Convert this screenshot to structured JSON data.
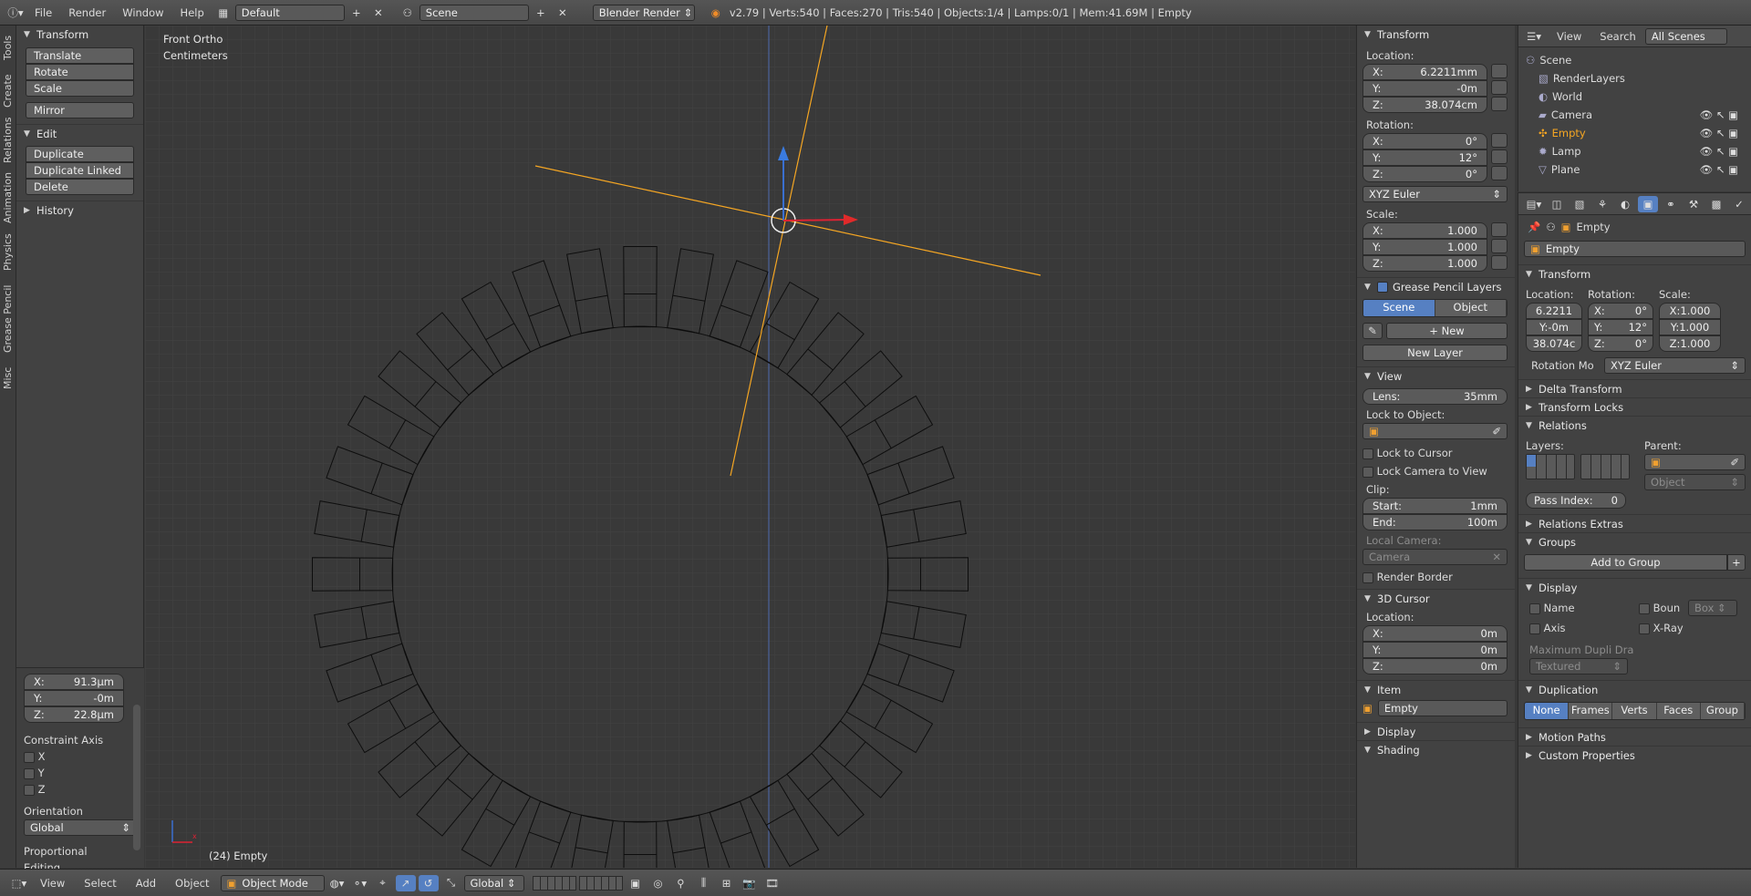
{
  "topbar": {
    "menus": [
      "File",
      "Render",
      "Window",
      "Help"
    ],
    "layout": "Default",
    "scene": "Scene",
    "engine": "Blender Render",
    "stats": "v2.79 | Verts:540 | Faces:270 | Tris:540 | Objects:1/4 | Lamps:0/1 | Mem:41.69M | Empty"
  },
  "tool_tabs": [
    "Tools",
    "Create",
    "Relations",
    "Animation",
    "Physics",
    "Grease Pencil",
    "Misc"
  ],
  "toolshelf": {
    "transform_hdr": "Transform",
    "transform_btns": [
      "Translate",
      "Rotate",
      "Scale"
    ],
    "mirror": "Mirror",
    "edit_hdr": "Edit",
    "edit_btns": [
      "Duplicate",
      "Duplicate Linked",
      "Delete"
    ],
    "history_hdr": "History"
  },
  "redo": {
    "x_lbl": "X:",
    "x": "91.3µm",
    "y_lbl": "Y:",
    "y": "-0m",
    "z_lbl": "Z:",
    "z": "22.8µm",
    "constraint_hdr": "Constraint Axis",
    "cx": "X",
    "cy": "Y",
    "cz": "Z",
    "orientation_lbl": "Orientation",
    "orientation": "Global",
    "prop_edit": "Proportional Editing"
  },
  "viewport": {
    "view_name": "Front Ortho",
    "units": "Centimeters",
    "object_label": "(24) Empty"
  },
  "npanel": {
    "transform_hdr": "Transform",
    "location_lbl": "Location:",
    "loc": [
      {
        "k": "X:",
        "v": "6.2211mm"
      },
      {
        "k": "Y:",
        "v": "-0m"
      },
      {
        "k": "Z:",
        "v": "38.074cm"
      }
    ],
    "rotation_lbl": "Rotation:",
    "rot": [
      {
        "k": "X:",
        "v": "0°"
      },
      {
        "k": "Y:",
        "v": "12°"
      },
      {
        "k": "Z:",
        "v": "0°"
      }
    ],
    "rot_mode": "XYZ Euler",
    "scale_lbl": "Scale:",
    "scale": [
      {
        "k": "X:",
        "v": "1.000"
      },
      {
        "k": "Y:",
        "v": "1.000"
      },
      {
        "k": "Z:",
        "v": "1.000"
      }
    ],
    "gp_hdr": "Grease Pencil Layers",
    "gp_scene": "Scene",
    "gp_object": "Object",
    "gp_new": "New",
    "gp_new_layer": "New Layer",
    "view_hdr": "View",
    "lens_lbl": "Lens:",
    "lens": "35mm",
    "lock_obj_lbl": "Lock to Object:",
    "lock_cursor": "Lock to Cursor",
    "lock_cam": "Lock Camera to View",
    "clip_lbl": "Clip:",
    "start_lbl": "Start:",
    "start": "1mm",
    "end_lbl": "End:",
    "end": "100m",
    "local_cam_lbl": "Local Camera:",
    "local_cam": "Camera",
    "render_border": "Render Border",
    "cursor_hdr": "3D Cursor",
    "cursor_loc_lbl": "Location:",
    "cursor": [
      {
        "k": "X:",
        "v": "0m"
      },
      {
        "k": "Y:",
        "v": "0m"
      },
      {
        "k": "Z:",
        "v": "0m"
      }
    ],
    "item_hdr": "Item",
    "item_name": "Empty",
    "display_hdr": "Display",
    "shading_hdr": "Shading"
  },
  "outliner": {
    "menus": [
      "View",
      "Search"
    ],
    "scope": "All Scenes",
    "items": [
      "Scene",
      "RenderLayers",
      "World",
      "Camera",
      "Empty",
      "Lamp",
      "Plane"
    ]
  },
  "props": {
    "breadcrumb": "Empty",
    "name": "Empty",
    "transform_hdr": "Transform",
    "loc_lbl": "Location:",
    "rot_lbl": "Rotation:",
    "scale_lbl": "Scale:",
    "loc": [
      "6.2211",
      "-0m",
      "38.074c"
    ],
    "rot_k": [
      "X:",
      "Y:",
      "Z:"
    ],
    "rot": [
      "0°",
      "12°",
      "0°"
    ],
    "scale": [
      "X:1.000",
      "Y:1.000",
      "Z:1.000"
    ],
    "rot_mode_lbl": "Rotation Mo",
    "rot_mode": "XYZ Euler",
    "delta": "Delta Transform",
    "locks": "Transform Locks",
    "relations": "Relations",
    "layers_lbl": "Layers:",
    "parent_lbl": "Parent:",
    "parent_type": "Object",
    "pass_lbl": "Pass Index:",
    "pass": "0",
    "rel_extras": "Relations Extras",
    "groups": "Groups",
    "add_group": "Add to Group",
    "display": "Display",
    "name_opt": "Name",
    "bounds_opt": "Boun",
    "bounds_type": "Box",
    "axis_opt": "Axis",
    "xray_opt": "X-Ray",
    "max_dupli": "Maximum Dupli Dra",
    "dupli_mode": "Textured",
    "duplication": "Duplication",
    "dup_opts": [
      "None",
      "Frames",
      "Verts",
      "Faces",
      "Group"
    ],
    "motion": "Motion Paths",
    "custom": "Custom Properties"
  },
  "bottombar": {
    "menus": [
      "View",
      "Select",
      "Add",
      "Object"
    ],
    "mode": "Object Mode",
    "orientation": "Global"
  },
  "colors": {
    "accent": "#5680c2",
    "selected_text": "#f5a623",
    "viewport_bg": "#393939",
    "grid": "#444444"
  }
}
